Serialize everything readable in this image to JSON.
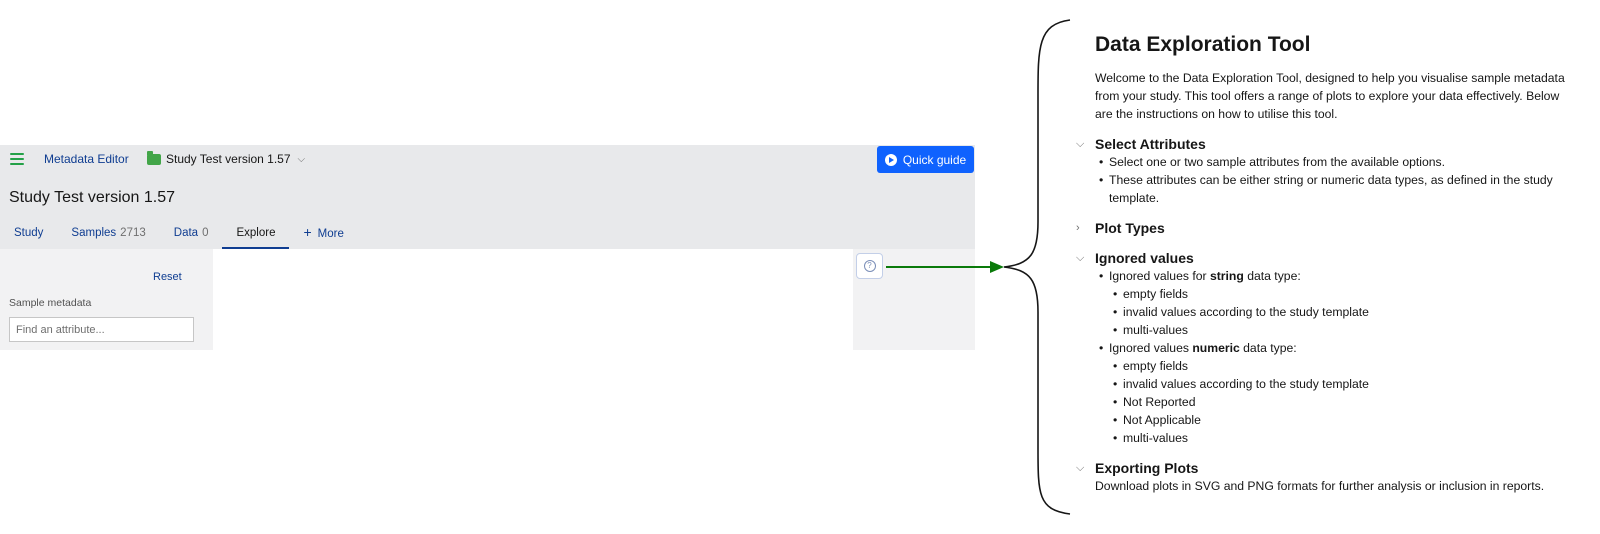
{
  "app": {
    "name": "Metadata Editor",
    "study_crumb": "Study Test version 1.57",
    "quick_guide_label": "Quick guide",
    "page_title": "Study Test version 1.57",
    "tabs": [
      {
        "label": "Study",
        "count": ""
      },
      {
        "label": "Samples",
        "count": "2713"
      },
      {
        "label": "Data",
        "count": "0"
      },
      {
        "label": "Explore",
        "count": ""
      },
      {
        "label": "More",
        "count": ""
      }
    ],
    "active_tab": "Explore",
    "reset_label": "Reset",
    "sample_metadata_label": "Sample metadata",
    "attribute_placeholder": "Find an attribute...",
    "accent_color": "#0f62fe",
    "connector_color": "#0a7a0a"
  },
  "guide": {
    "title": "Data Exploration Tool",
    "intro": "Welcome to the Data Exploration Tool, designed to help you visualise sample metadata from your study. This tool offers a range of plots to explore your data effectively. Below are the instructions on how to utilise this tool.",
    "select_attributes": {
      "heading": "Select Attributes",
      "expanded": true,
      "items": [
        "Select one or two sample attributes from the available options.",
        "These attributes can be either string or numeric data types, as defined in the study template."
      ]
    },
    "plot_types": {
      "heading": "Plot Types",
      "expanded": false
    },
    "ignored_values": {
      "heading": "Ignored values",
      "expanded": true,
      "string_prefix": "Ignored values for ",
      "string_keyword": "string",
      "string_suffix": " data type:",
      "string_items": [
        "empty fields",
        "invalid values according to the study template",
        "multi-values"
      ],
      "numeric_prefix": "Ignored values ",
      "numeric_keyword": "numeric",
      "numeric_suffix": " data type:",
      "numeric_items": [
        "empty fields",
        "invalid values according to the study template",
        "Not Reported",
        "Not Applicable",
        "multi-values"
      ]
    },
    "exporting_plots": {
      "heading": "Exporting Plots",
      "expanded": true,
      "text": "Download plots in SVG and PNG formats for further analysis or inclusion in reports."
    }
  }
}
